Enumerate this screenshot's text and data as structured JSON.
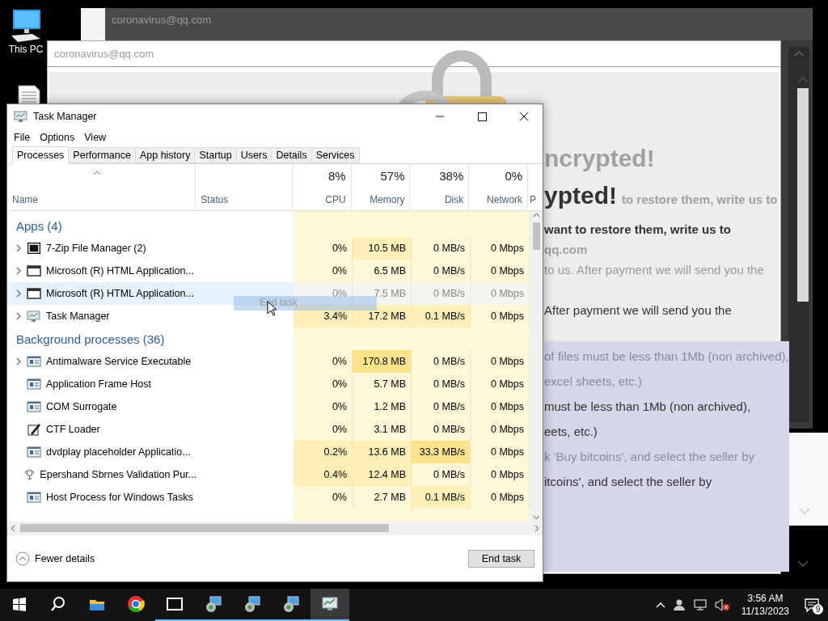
{
  "desktop": {
    "icons": [
      {
        "kind": "pc",
        "label": "This PC"
      },
      {
        "kind": "document"
      }
    ]
  },
  "back_window": {
    "title": "coronavirus@qq.com"
  },
  "ransom_window": {
    "title": "coronavirus@qq.com",
    "upper_lines": [
      [
        {
          "kind": "ghost-heading",
          "text": "ncrypted!"
        }
      ],
      [
        {
          "kind": "heading",
          "text": "ypted!"
        },
        {
          "kind": "ghost-bold",
          "text": "to restore them, write us to"
        }
      ],
      [
        {
          "kind": "bold",
          "text": "want to restore them, write us to"
        }
      ],
      [
        {
          "kind": "ghost-bold",
          "text": "qq.com"
        }
      ],
      [
        {
          "kind": "ghost",
          "text": "to us. After payment we will send you the"
        }
      ],
      [
        {
          "kind": "text",
          "text": "After payment we will send you the"
        }
      ]
    ],
    "lower_lines": [
      [
        {
          "kind": "ghost",
          "text": "of files must be less than 1Mb (non archived),"
        }
      ],
      [
        {
          "kind": "ghost",
          "text": "excel sheets, etc.)"
        }
      ],
      [
        {
          "kind": "text",
          "text": "must be less than 1Mb (non archived),"
        }
      ],
      [
        {
          "kind": "text",
          "text": "eets, etc.)"
        }
      ],
      [
        {
          "kind": "ghost",
          "text": "k 'Buy bitcoins', and select the seller by"
        }
      ],
      [
        {
          "kind": "text",
          "text": "itcoins', and select the seller by"
        }
      ]
    ]
  },
  "task_manager": {
    "title": "Task Manager",
    "menu": [
      "File",
      "Options",
      "View"
    ],
    "tabs": [
      {
        "label": "Processes",
        "selected": true
      },
      {
        "label": "Performance",
        "selected": false
      },
      {
        "label": "App history",
        "selected": false
      },
      {
        "label": "Startup",
        "selected": false
      },
      {
        "label": "Users",
        "selected": false
      },
      {
        "label": "Details",
        "selected": false
      },
      {
        "label": "Services",
        "selected": false
      }
    ],
    "columns": [
      {
        "kind": "name",
        "label": "Name"
      },
      {
        "kind": "status",
        "label": "Status"
      },
      {
        "kind": "metric",
        "percent": "8%",
        "label": "CPU"
      },
      {
        "kind": "metric",
        "percent": "57%",
        "label": "Memory"
      },
      {
        "kind": "metric",
        "percent": "38%",
        "label": "Disk"
      },
      {
        "kind": "metric",
        "percent": "0%",
        "label": "Network"
      },
      {
        "kind": "cut",
        "label": "P"
      }
    ],
    "groups": [
      {
        "label": "Apps (4)",
        "processes": [
          {
            "name": "7-Zip File Manager (2)",
            "kind": "sevenzip",
            "expandable": true,
            "highlighted": false,
            "cells": [
              {
                "value": "0%",
                "color": "#fff8d8"
              },
              {
                "value": "10.5 MB",
                "color": "#fff0b8"
              },
              {
                "value": "0 MB/s",
                "color": "#fff8d8"
              },
              {
                "value": "0 Mbps",
                "color": "#fff8d8"
              }
            ]
          },
          {
            "name": "Microsoft (R) HTML Application...",
            "kind": "window",
            "expandable": true,
            "highlighted": false,
            "cells": [
              {
                "value": "0%",
                "color": "#fff8d8"
              },
              {
                "value": "6.5 MB",
                "color": "#fff8d8"
              },
              {
                "value": "0 MB/s",
                "color": "#fff8d8"
              },
              {
                "value": "0 Mbps",
                "color": "#fff8d8"
              }
            ]
          },
          {
            "name": "Microsoft (R) HTML Application...",
            "kind": "window",
            "expandable": true,
            "highlighted": true,
            "cells": [
              {
                "value": "0%",
                "color": "#f4f4f0"
              },
              {
                "value": "7.5 MB",
                "color": "#f4f4f0"
              },
              {
                "value": "0 MB/s",
                "color": "#f4f4f0"
              },
              {
                "value": "0 Mbps",
                "color": "#f4f4f0"
              }
            ]
          },
          {
            "name": "Task Manager",
            "kind": "taskmgr",
            "expandable": true,
            "highlighted": false,
            "cells": [
              {
                "value": "3.4%",
                "color": "#fff0b8"
              },
              {
                "value": "17.2 MB",
                "color": "#fff0b8"
              },
              {
                "value": "0.1 MB/s",
                "color": "#fff0b8"
              },
              {
                "value": "0 Mbps",
                "color": "#fff8d8"
              }
            ]
          }
        ]
      },
      {
        "label": "Background processes (36)",
        "processes": [
          {
            "name": "Antimalware Service Executable",
            "kind": "service",
            "expandable": true,
            "highlighted": false,
            "cells": [
              {
                "value": "0%",
                "color": "#fff8d8"
              },
              {
                "value": "170.8 MB",
                "color": "#ffe28c"
              },
              {
                "value": "0 MB/s",
                "color": "#fff8d8"
              },
              {
                "value": "0 Mbps",
                "color": "#fff8d8"
              }
            ]
          },
          {
            "name": "Application Frame Host",
            "kind": "service",
            "expandable": false,
            "highlighted": false,
            "cells": [
              {
                "value": "0%",
                "color": "#fff8d8"
              },
              {
                "value": "5.7 MB",
                "color": "#fff8d8"
              },
              {
                "value": "0 MB/s",
                "color": "#fff8d8"
              },
              {
                "value": "0 Mbps",
                "color": "#fff8d8"
              }
            ]
          },
          {
            "name": "COM Surrogate",
            "kind": "service",
            "expandable": false,
            "highlighted": false,
            "cells": [
              {
                "value": "0%",
                "color": "#fff8d8"
              },
              {
                "value": "1.2 MB",
                "color": "#fff8d8"
              },
              {
                "value": "0 MB/s",
                "color": "#fff8d8"
              },
              {
                "value": "0 Mbps",
                "color": "#fff8d8"
              }
            ]
          },
          {
            "name": "CTF Loader",
            "kind": "pen",
            "expandable": false,
            "highlighted": false,
            "cells": [
              {
                "value": "0%",
                "color": "#fff8d8"
              },
              {
                "value": "3.1 MB",
                "color": "#fff8d8"
              },
              {
                "value": "0 MB/s",
                "color": "#fff8d8"
              },
              {
                "value": "0 Mbps",
                "color": "#fff8d8"
              }
            ]
          },
          {
            "name": "dvdplay placeholder Applicatio...",
            "kind": "service",
            "expandable": false,
            "highlighted": false,
            "cells": [
              {
                "value": "0.2%",
                "color": "#fff0b8"
              },
              {
                "value": "13.6 MB",
                "color": "#fff0b8"
              },
              {
                "value": "33.3 MB/s",
                "color": "#ffe28c"
              },
              {
                "value": "0 Mbps",
                "color": "#fff8d8"
              }
            ]
          },
          {
            "name": "Epershand Sbrnes Validation Pur...",
            "kind": "trophy",
            "expandable": false,
            "highlighted": false,
            "cells": [
              {
                "value": "0.4%",
                "color": "#fff0b8"
              },
              {
                "value": "12.4 MB",
                "color": "#fff0b8"
              },
              {
                "value": "0 MB/s",
                "color": "#fff8d8"
              },
              {
                "value": "0 Mbps",
                "color": "#fff8d8"
              }
            ]
          },
          {
            "name": "Host Process for Windows Tasks",
            "kind": "service",
            "expandable": false,
            "highlighted": false,
            "cells": [
              {
                "value": "0%",
                "color": "#fff8d8"
              },
              {
                "value": "2.7 MB",
                "color": "#fff8d8"
              },
              {
                "value": "0.1 MB/s",
                "color": "#fff0b8"
              },
              {
                "value": "0 Mbps",
                "color": "#fff8d8"
              }
            ]
          }
        ]
      }
    ],
    "drag_ghost": {
      "label": "End task"
    },
    "fewer_details": "Fewer details",
    "end_task": "End task"
  },
  "taskbar": {
    "items": [
      {
        "kind": "start",
        "running": false,
        "active": false
      },
      {
        "kind": "search",
        "running": false,
        "active": false
      },
      {
        "kind": "explorer",
        "running": false,
        "active": false
      },
      {
        "kind": "chrome",
        "running": false,
        "active": false
      },
      {
        "kind": "sevenzip",
        "running": true,
        "active": false
      },
      {
        "kind": "hta",
        "running": true,
        "active": false
      },
      {
        "kind": "hta",
        "running": true,
        "active": false
      },
      {
        "kind": "hta",
        "running": true,
        "active": false
      },
      {
        "kind": "taskmgr",
        "running": true,
        "active": true
      }
    ],
    "tray": [
      {
        "kind": "chevron"
      },
      {
        "kind": "people"
      },
      {
        "kind": "network"
      },
      {
        "kind": "volume-muted"
      }
    ],
    "time": "3:56 AM",
    "date": "11/13/2023",
    "notifications": "9"
  }
}
